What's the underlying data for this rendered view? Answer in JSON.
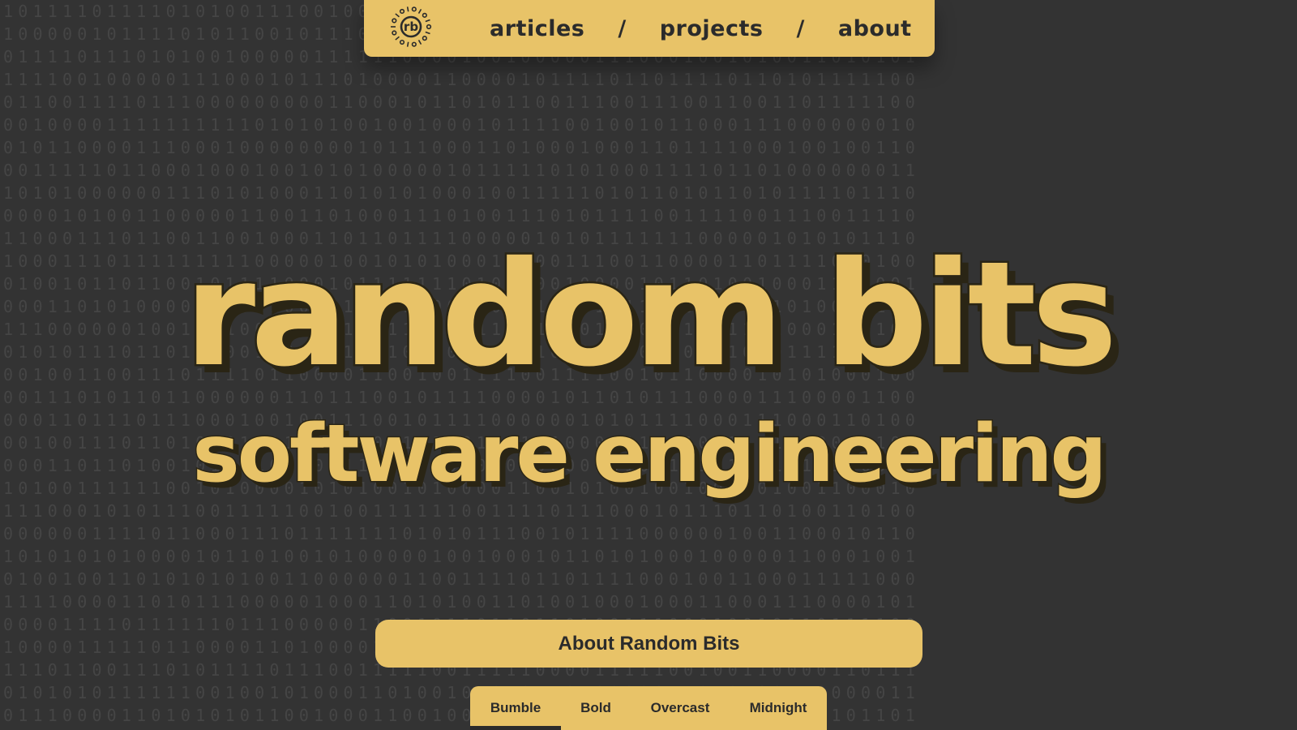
{
  "nav": {
    "logo_label": "rb",
    "links": [
      {
        "label": "articles"
      },
      {
        "label": "projects"
      },
      {
        "label": "about"
      }
    ],
    "separator": "/"
  },
  "hero": {
    "title": "random bits",
    "subtitle": "software engineering"
  },
  "about_button": {
    "label": "About Random Bits"
  },
  "theme_tabs": {
    "items": [
      {
        "label": "Bumble",
        "active": true
      },
      {
        "label": "Bold",
        "active": false
      },
      {
        "label": "Overcast",
        "active": false
      },
      {
        "label": "Midnight",
        "active": false
      }
    ]
  },
  "colors": {
    "background": "#333333",
    "accent": "#e8c368",
    "text_dark": "#2b2b2b",
    "binary_digits": "#454545"
  },
  "icons": {
    "logo": "rb-binary-ring-logo"
  }
}
